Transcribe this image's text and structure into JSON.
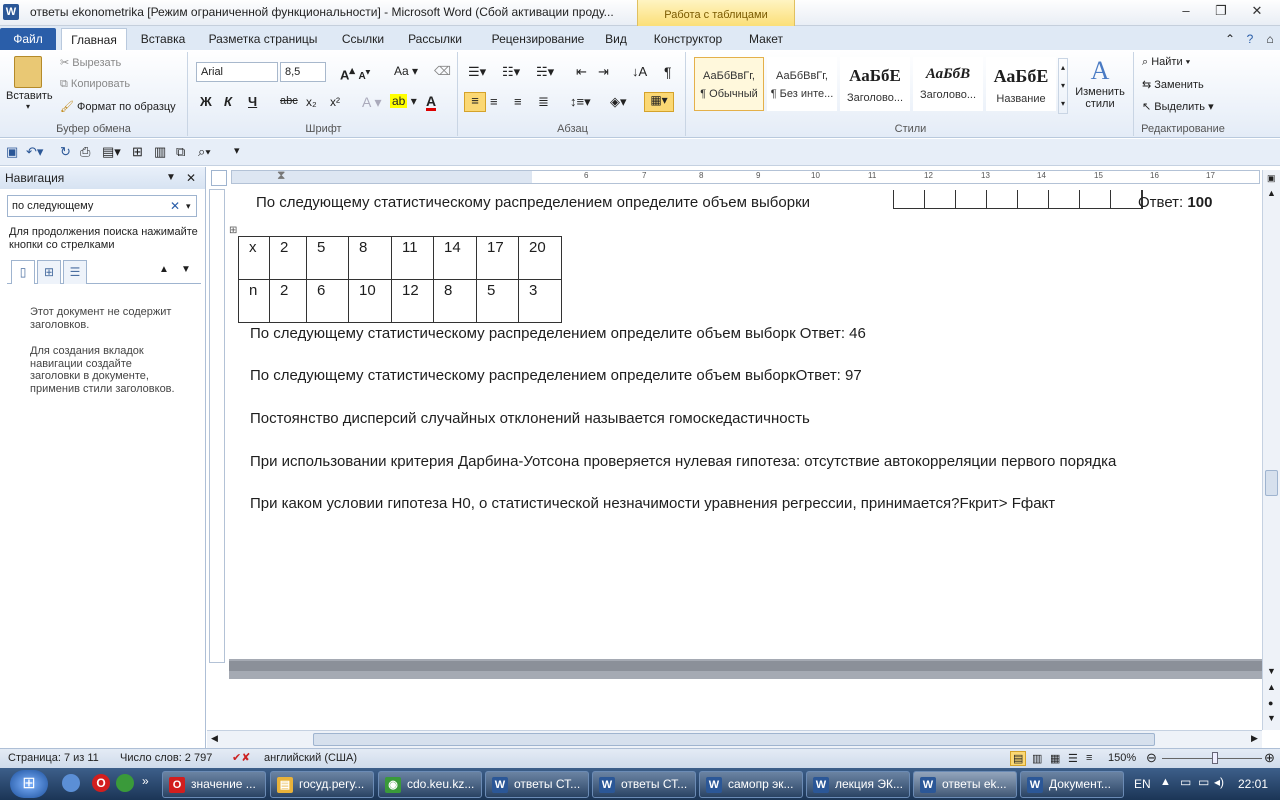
{
  "window": {
    "title": "ответы ekonometrika [Режим ограниченной функциональности]  -  Microsoft Word (Сбой активации проду...",
    "context_tab": "Работа с таблицами",
    "app_icon": "W"
  },
  "tabs": [
    "Файл",
    "Главная",
    "Вставка",
    "Разметка страницы",
    "Ссылки",
    "Рассылки",
    "Рецензирование",
    "Вид",
    "Конструктор",
    "Макет"
  ],
  "ribbon": {
    "clipboard": {
      "paste": "Вставить",
      "cut": "Вырезать",
      "copy": "Копировать",
      "format_painter": "Формат по образцу",
      "label": "Буфер обмена"
    },
    "font": {
      "name": "Arial",
      "size": "8,5",
      "label": "Шрифт",
      "bold": "Ж",
      "italic": "К",
      "underline": "Ч",
      "strike": "abc",
      "sub": "x₂",
      "sup": "x²",
      "grow": "A",
      "case": "Aa"
    },
    "paragraph": {
      "label": "Абзац",
      "pilcrow": "¶"
    },
    "styles": {
      "label": "Стили",
      "items": [
        {
          "preview": "АаБбВвГг,",
          "name": "¶ Обычный"
        },
        {
          "preview": "АаБбВвГг,",
          "name": "¶ Без инте..."
        },
        {
          "preview": "АаБбЕ",
          "name": "Заголово..."
        },
        {
          "preview": "АаБбВ",
          "name": "Заголово..."
        },
        {
          "preview": "АаБбЕ",
          "name": "Название"
        }
      ],
      "change": "Изменить стили"
    },
    "editing": {
      "label": "Редактирование",
      "find": "Найти",
      "replace": "Заменить",
      "select": "Выделить"
    }
  },
  "nav": {
    "title": "Навигация",
    "search_value": "по следующему",
    "hint": "Для продолжения поиска нажимайте кнопки со стрелками",
    "msg1": "Этот документ не содержит заголовков.",
    "msg2": "Для создания вкладок навигации создайте заголовки в документе, применив стили заголовков."
  },
  "document": {
    "line1_text": "По следующему статистическому распределением определите объем выборки",
    "line1_answer_label": "Ответ:",
    "line1_answer": "100",
    "table": {
      "rows": [
        [
          "x",
          "2",
          "5",
          "8",
          "11",
          "14",
          "17",
          "20"
        ],
        [
          "n",
          "2",
          "6",
          "10",
          "12",
          "8",
          "5",
          "3"
        ]
      ]
    },
    "line2": "По следующему статистическому распределением определите объем выборк Ответ: 46",
    "line3": " По следующему статистическому распределением определите объем выборкОтвет: 97",
    "line4": "Постоянство дисперсий случайных отклонений называется гомоскедастичность",
    "line5": "При использовании критерия Дарбина-Уотсона проверяется нулевая гипотеза: отсутствие автокорреляции первого порядка",
    "line6": "При каком условии гипотеза H0, о статистической незначимости уравнения регрессии, принимается?Fкрит> Fфакт"
  },
  "status": {
    "page": "Страница: 7 из 11",
    "words": "Число слов: 2 797",
    "lang": "английский (США)",
    "zoom": "150%"
  },
  "taskbar": {
    "items": [
      {
        "label": "значение ...",
        "icon": "O",
        "color": "#d21e1e"
      },
      {
        "label": "госуд.регу...",
        "icon": "▤",
        "color": "#e8b23a"
      },
      {
        "label": "cdo.keu.kz...",
        "icon": "◉",
        "color": "#3a9a3a"
      },
      {
        "label": "ответы СТ...",
        "icon": "W",
        "color": "#2b5797"
      },
      {
        "label": "ответы СТ...",
        "icon": "W",
        "color": "#2b5797"
      },
      {
        "label": "самопр эк...",
        "icon": "W",
        "color": "#2b5797"
      },
      {
        "label": "лекция ЭК...",
        "icon": "W",
        "color": "#2b5797"
      },
      {
        "label": "ответы ek...",
        "icon": "W",
        "color": "#2b5797"
      },
      {
        "label": "Документ...",
        "icon": "W",
        "color": "#2b5797"
      }
    ],
    "lang": "EN",
    "time": "22:01"
  }
}
